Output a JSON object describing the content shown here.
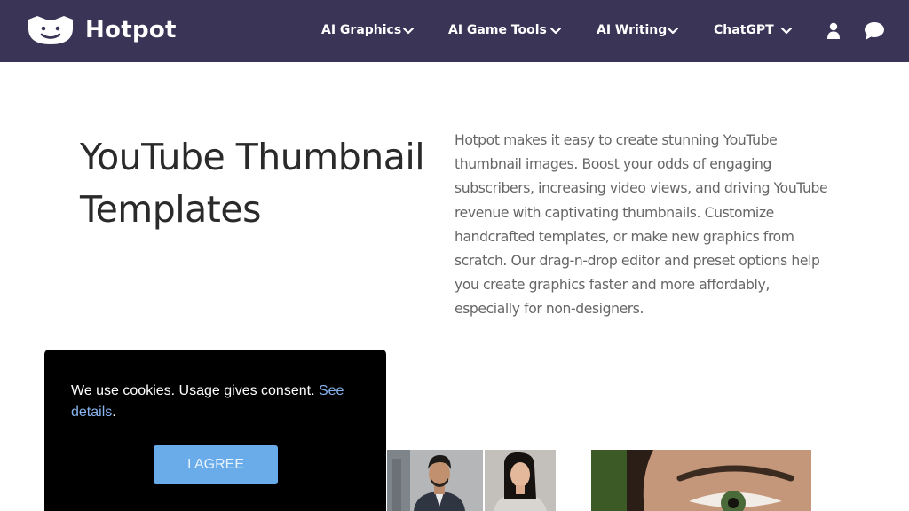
{
  "brand": {
    "name": "Hotpot"
  },
  "nav": {
    "items": [
      {
        "label": "AI Graphics"
      },
      {
        "label": "AI Game Tools"
      },
      {
        "label": "AI Writing"
      },
      {
        "label": "ChatGPT"
      }
    ],
    "icons": [
      "user-icon",
      "chat-bubble-icon",
      "chevron-down-icon"
    ]
  },
  "hero": {
    "title_line1": "YouTube Thumbnail",
    "title_line2": "Templates",
    "description": "Hotpot makes it easy to create stunning YouTube thumbnail images. Boost your odds of engaging subscribers, increasing video views, and driving YouTube revenue with captivating thumbnails. Customize handcrafted templates, or make new graphics from scratch. Our drag-n-drop editor and preset options help you create graphics faster and more affordably, especially for non-designers."
  },
  "cookie": {
    "text": "We use cookies. Usage gives consent.",
    "link_text": "See details",
    "trailing": ".",
    "button_label": "I AGREE"
  },
  "colors": {
    "navbar_bg": "#3a3457",
    "cookie_bg": "#000000",
    "cookie_link": "#8ab4f0",
    "agree_button": "#6aacea"
  }
}
